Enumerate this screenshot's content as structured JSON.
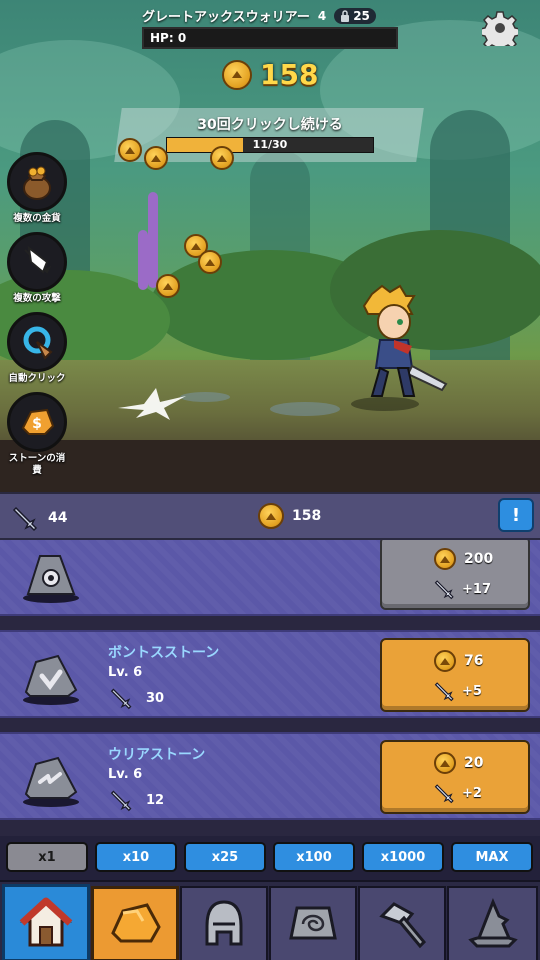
{
  "monster": {
    "name": "グレートアックスウォリアー",
    "level": "4",
    "lock_count": "25",
    "hp_text": "HP: 0"
  },
  "gold_total": "158",
  "quest": {
    "title": "30回クリックし続ける",
    "progress_text": "11/30",
    "progress_fraction": 0.3667
  },
  "skills": [
    {
      "label": "複数の金貨",
      "icon": "coin-bag-icon"
    },
    {
      "label": "複数の攻撃",
      "icon": "multi-sword-icon"
    },
    {
      "label": "自動クリック",
      "icon": "auto-click-icon"
    },
    {
      "label": "ストーンの消費",
      "icon": "stone-spend-icon"
    }
  ],
  "stats": {
    "attack": "44",
    "gold": "158",
    "info_label": "!"
  },
  "upgrades": [
    {
      "name": "",
      "level": "",
      "damage": "",
      "cost": "200",
      "gain": "+17",
      "state": "gray"
    },
    {
      "name": "ボントスストーン",
      "level": "Lv. 6",
      "damage": "30",
      "cost": "76",
      "gain": "+5",
      "state": "gold"
    },
    {
      "name": "ウリアストーン",
      "level": "Lv. 6",
      "damage": "12",
      "cost": "20",
      "gain": "+2",
      "state": "gold"
    }
  ],
  "multipliers": [
    {
      "label": "x1",
      "selected": true
    },
    {
      "label": "x10",
      "selected": false
    },
    {
      "label": "x25",
      "selected": false
    },
    {
      "label": "x100",
      "selected": false
    },
    {
      "label": "x1000",
      "selected": false
    },
    {
      "label": "MAX",
      "selected": false
    }
  ],
  "tabs": [
    {
      "icon": "home-icon"
    },
    {
      "icon": "stone-icon"
    },
    {
      "icon": "helmet-icon"
    },
    {
      "icon": "spiral-stone-icon"
    },
    {
      "icon": "hammer-icon"
    },
    {
      "icon": "wizard-hat-icon"
    }
  ],
  "colors": {
    "gold": "#ffd84a",
    "button_gold": "#eaa238",
    "button_blue": "#2f8ee0",
    "row_purple": "#5b58a8"
  }
}
